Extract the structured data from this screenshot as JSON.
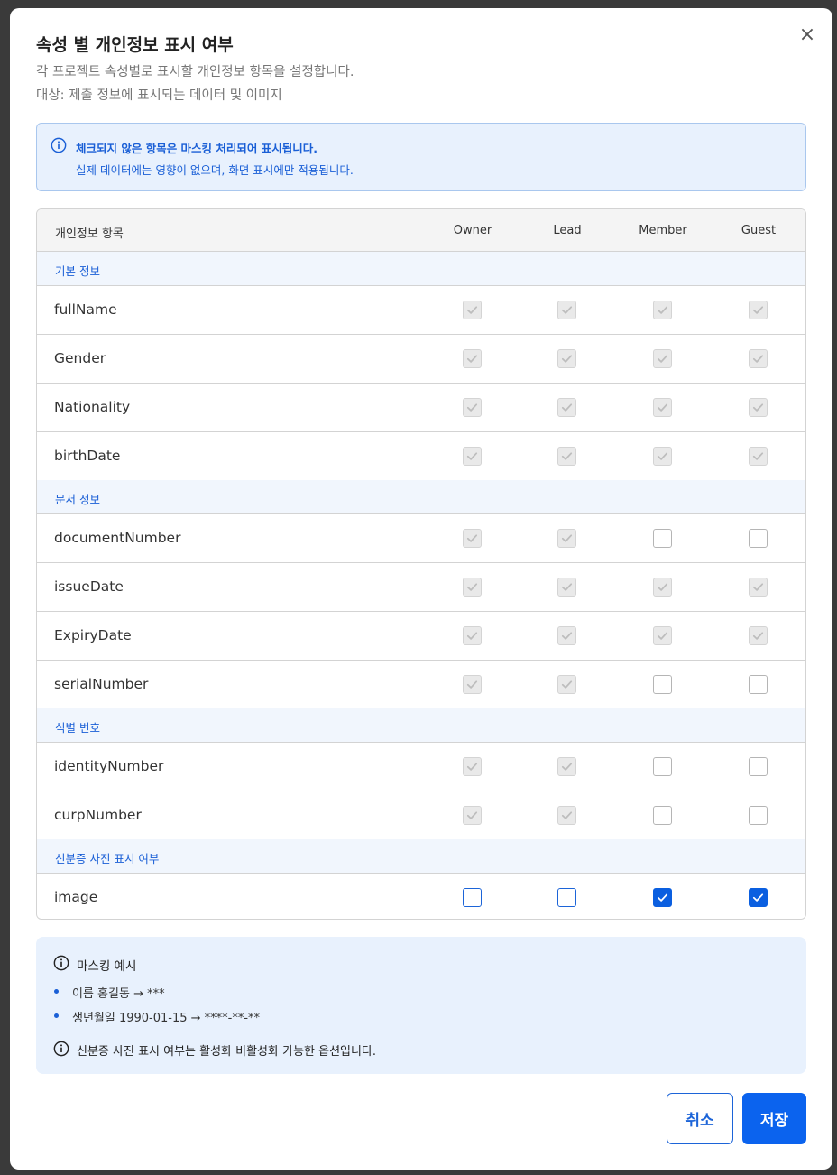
{
  "dialog": {
    "title": "속성 별 개인정보 표시 여부",
    "subtitle_1": "각 프로젝트 속성별로 표시할 개인정보 항목을 설정합니다.",
    "subtitle_2": "대상: 제출 정보에 표시되는 데이터 및 이미지",
    "close_label": "×"
  },
  "info": {
    "line_1": "체크되지 않은 항목은 마스킹 처리되어 표시됩니다.",
    "line_2": "실제 데이터에는 영향이 없으며, 화면 표시에만 적용됩니다.",
    "icon": "info-icon"
  },
  "table": {
    "header_item": "개인정보 항목",
    "columns": [
      "Owner",
      "Lead",
      "Member",
      "Guest"
    ],
    "groups": [
      {
        "label": "기본 정보",
        "rows": [
          {
            "label": "fullName",
            "checks": [
              "dis-on",
              "dis-on",
              "dis-on",
              "dis-on"
            ]
          },
          {
            "label": "Gender",
            "checks": [
              "dis-on",
              "dis-on",
              "dis-on",
              "dis-on"
            ]
          },
          {
            "label": "Nationality",
            "checks": [
              "dis-on",
              "dis-on",
              "dis-on",
              "dis-on"
            ]
          },
          {
            "label": "birthDate",
            "checks": [
              "dis-on",
              "dis-on",
              "dis-on",
              "dis-on"
            ]
          }
        ]
      },
      {
        "label": "문서 정보",
        "rows": [
          {
            "label": "documentNumber",
            "checks": [
              "dis-on",
              "dis-on",
              "dis-off",
              "dis-off"
            ]
          },
          {
            "label": "issueDate",
            "checks": [
              "dis-on",
              "dis-on",
              "dis-on",
              "dis-on"
            ]
          },
          {
            "label": "ExpiryDate",
            "checks": [
              "dis-on",
              "dis-on",
              "dis-on",
              "dis-on"
            ]
          },
          {
            "label": "serialNumber",
            "checks": [
              "dis-on",
              "dis-on",
              "dis-off",
              "dis-off"
            ]
          }
        ]
      },
      {
        "label": "식별 번호",
        "rows": [
          {
            "label": "identityNumber",
            "checks": [
              "dis-on",
              "dis-on",
              "dis-off",
              "dis-off"
            ]
          },
          {
            "label": "curpNumber",
            "checks": [
              "dis-on",
              "dis-on",
              "dis-off",
              "dis-off"
            ]
          }
        ]
      },
      {
        "label": "신분증 사진 표시 여부",
        "rows": [
          {
            "label": "image",
            "checks": [
              "off",
              "off",
              "on",
              "on"
            ]
          }
        ]
      }
    ]
  },
  "masking": {
    "title": "마스킹 예시",
    "items": [
      "이름 홍길동 → ***",
      "생년월일 1990-01-15 → ****-**-**"
    ],
    "note": "신분증 사진 표시 여부는 활성화 비활성화 가능한 옵션입니다."
  },
  "buttons": {
    "cancel": "취소",
    "save": "저장"
  },
  "colors": {
    "accent": "#0b63ee",
    "info_bg": "#e8f1fd",
    "info_text": "#1a5fd6"
  }
}
